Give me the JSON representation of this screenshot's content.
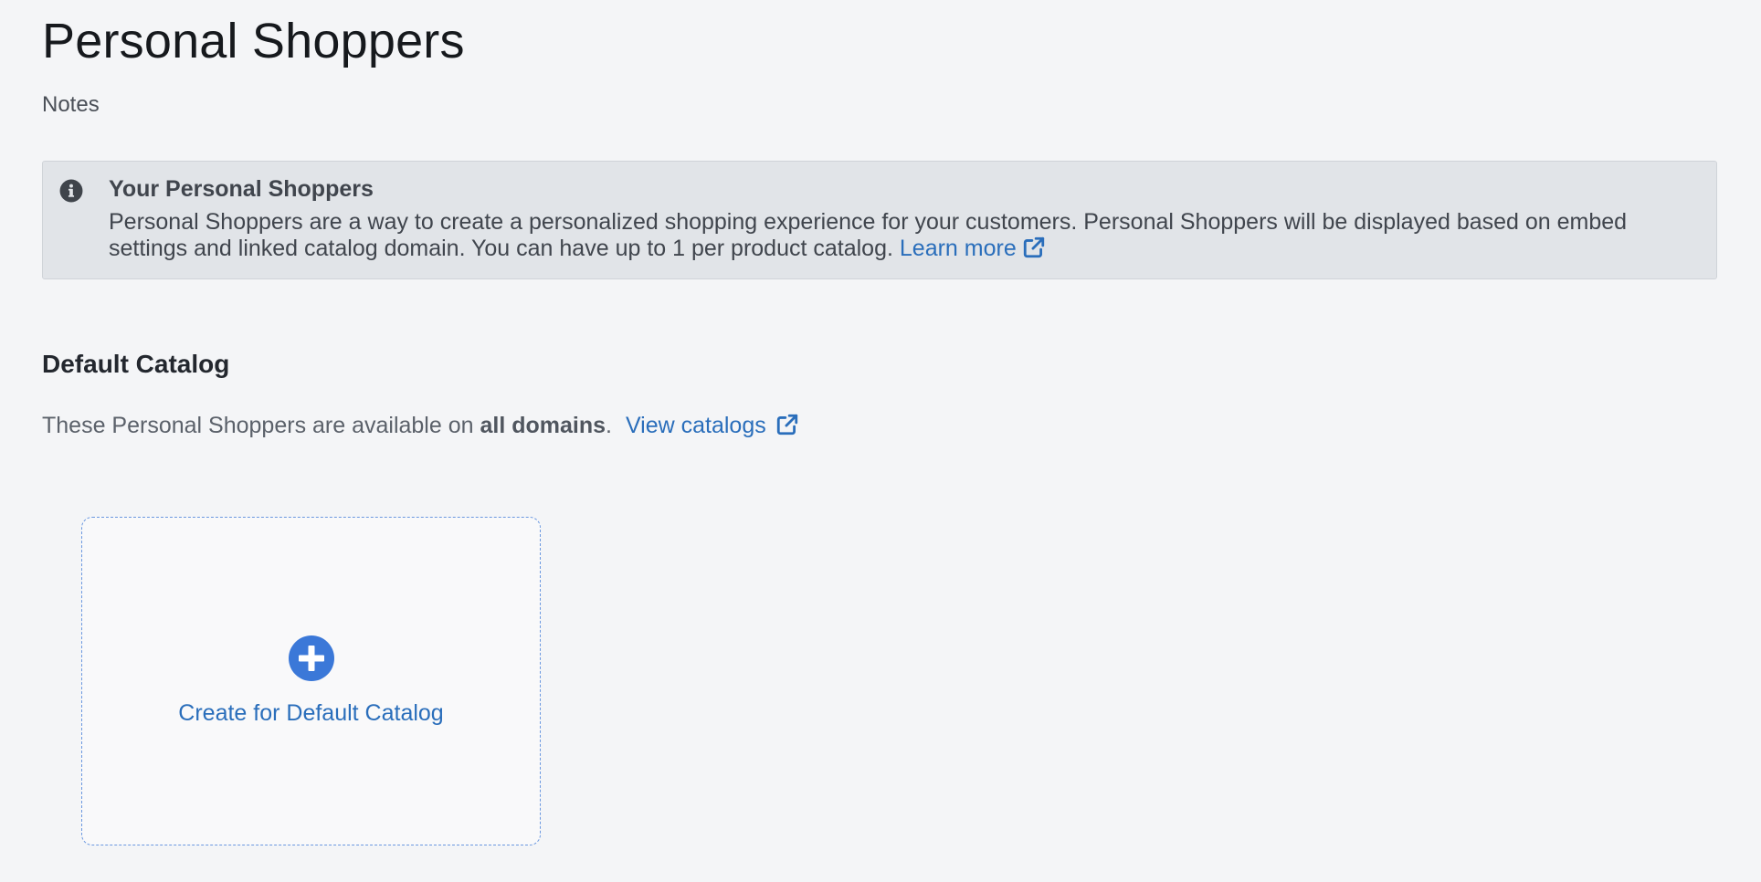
{
  "page": {
    "title": "Personal Shoppers",
    "notes_label": "Notes"
  },
  "banner": {
    "icon": "info-circle-icon",
    "title": "Your Personal Shoppers",
    "body": "Personal Shoppers are a way to create a personalized shopping experience for your customers. Personal Shoppers will be displayed based on embed settings and linked catalog domain. You can have up to 1 per product catalog.",
    "learn_more_label": "Learn more",
    "learn_more_icon": "external-link-icon"
  },
  "section": {
    "title": "Default Catalog",
    "desc_prefix": "These Personal Shoppers are available on",
    "desc_strong": "all domains",
    "desc_suffix": ".",
    "view_catalogs_label": "View catalogs",
    "view_catalogs_icon": "external-link-icon"
  },
  "create_card": {
    "icon": "plus-circle-icon",
    "label": "Create for Default Catalog"
  },
  "colors": {
    "background": "#f4f5f7",
    "banner_background": "#e1e4e8",
    "link": "#2a6ebb",
    "accent": "#3b78d8",
    "card_border": "#6b98e0"
  }
}
